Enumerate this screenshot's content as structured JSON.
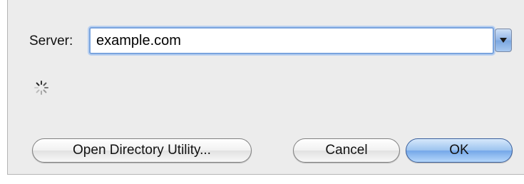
{
  "server": {
    "label": "Server:",
    "value": "example.com"
  },
  "buttons": {
    "open_directory_utility": "Open Directory Utility...",
    "cancel": "Cancel",
    "ok": "OK"
  },
  "colors": {
    "dialog_background": "#ececec",
    "focus_ring": "#7aa4de",
    "default_button": "#74a7e8"
  },
  "icons": {
    "combo_arrow": "chevron-down-icon",
    "spinner": "loading-spinner-icon"
  }
}
